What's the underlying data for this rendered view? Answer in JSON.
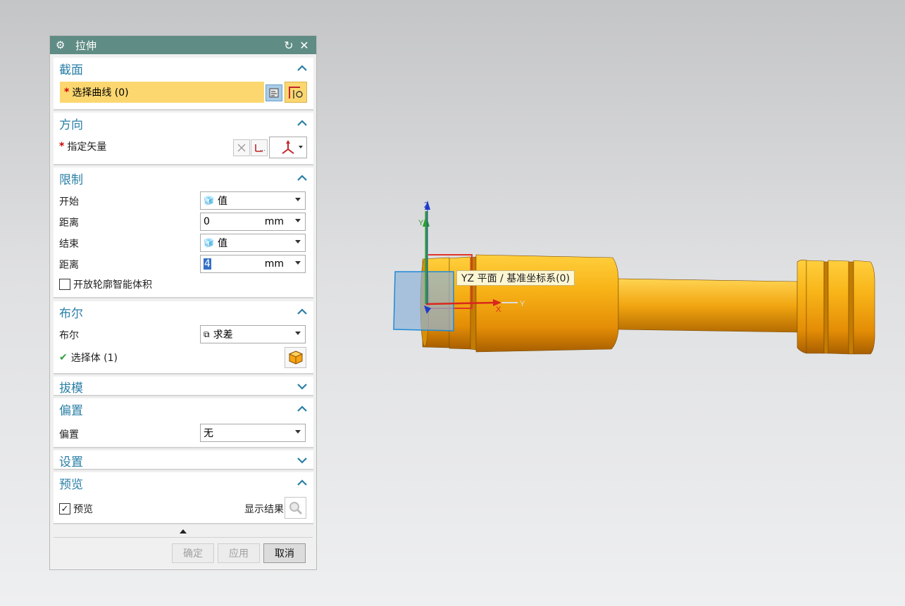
{
  "dialog": {
    "title": "拉伸",
    "sections": {
      "section": {
        "title": "截面",
        "select_curve": "选择曲线 (0)"
      },
      "direction": {
        "title": "方向",
        "specify_vector": "指定矢量"
      },
      "limits": {
        "title": "限制",
        "start_label": "开始",
        "start_value": "值",
        "start_distance_label": "距离",
        "start_distance_value": "0",
        "start_unit": "mm",
        "end_label": "结束",
        "end_value": "值",
        "end_distance_label": "距离",
        "end_distance_value": "4",
        "end_unit": "mm",
        "open_profile_label": "开放轮廓智能体积"
      },
      "boolean": {
        "title": "布尔",
        "boolean_label": "布尔",
        "boolean_value": "求差",
        "select_body": "选择体 (1)"
      },
      "draft": {
        "title": "拔模"
      },
      "offset": {
        "title": "偏置",
        "offset_label": "偏置",
        "offset_value": "无"
      },
      "settings": {
        "title": "设置"
      },
      "preview": {
        "title": "预览",
        "preview_label": "预览",
        "show_result_label": "显示结果"
      }
    },
    "buttons": {
      "ok": "确定",
      "apply": "应用",
      "cancel": "取消"
    }
  },
  "viewport": {
    "tooltip": "YZ 平面 / 基准坐标系(0)",
    "axis_labels": {
      "x": "X",
      "y": "Y",
      "z": "Z",
      "y2": "Y"
    }
  },
  "colors": {
    "title_bar": "#5f8c84",
    "section_title": "#2a7fa6",
    "highlight": "#fcd770",
    "part": "#f3a20f"
  },
  "icons": [
    "gear-icon",
    "reset-icon",
    "close-icon",
    "chevron-up-icon",
    "chevron-down-icon",
    "curve-select-icon",
    "sketch-icon",
    "vector-dialog-icon",
    "reverse-direction-icon",
    "vector-icon",
    "value-icon",
    "subtract-icon",
    "body-icon",
    "magnifier-icon",
    "check-icon"
  ]
}
